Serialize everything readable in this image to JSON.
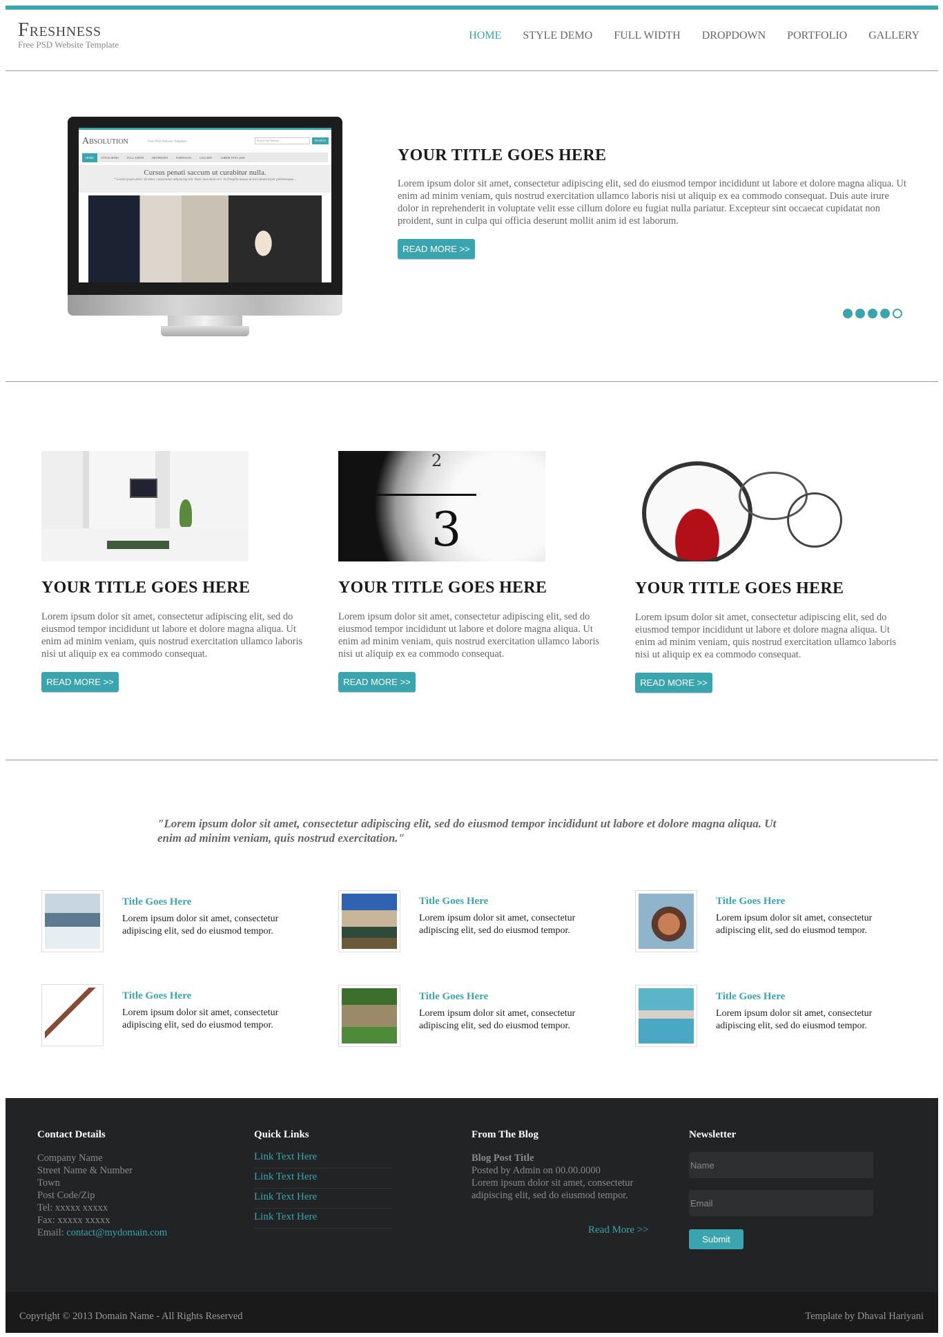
{
  "header": {
    "logo_title": "Freshness",
    "logo_subtitle": "Free PSD Website Template",
    "nav": [
      "HOME",
      "STYLE DEMO",
      "FULL WIDTH",
      "DROPDOWN",
      "PORTFOLIO",
      "GALLERY"
    ],
    "active_nav": "HOME"
  },
  "hero": {
    "screen": {
      "logo": "Absolution",
      "logo_sub": "Free PSD Website Template",
      "search_placeholder": "Search Our Website...",
      "search_button": "SEARCH",
      "nav": [
        "HOME",
        "STYLE DEMO",
        "FULL WIDTH",
        "DROPDOWN",
        "PORTFOLIO",
        "GALLERY",
        "LOREM TEXT LINE"
      ],
      "heading": "Cursus penati saccum ut curabitur nulla.",
      "subtext": "* Lorem ipsum dolor sit amet, consectetur adipiscing elit. Nunc non diam orci. In fringilla massa ut nisi ullamcorper pellentesque..."
    },
    "title": "YOUR TITLE GOES HERE",
    "text": "Lorem ipsum dolor sit amet, consectetur adipiscing elit, sed do eiusmod tempor incididunt ut labore et dolore magna aliqua. Ut enim ad minim veniam, quis nostrud exercitation ullamco laboris nisi ut aliquip ex ea commodo consequat. Duis aute irure dolor in reprehenderit in voluptate velit esse cillum dolore eu fugiat nulla pariatur. Excepteur sint occaecat cupidatat non proident, sunt in culpa qui officia deserunt mollit anim id est laborum.",
    "button": "READ MORE >>",
    "slides_total": 5,
    "slide_active": 5
  },
  "features": [
    {
      "title": "YOUR TITLE GOES HERE",
      "text": "Lorem ipsum dolor sit amet, consectetur adipiscing elit, sed do eiusmod tempor incididunt ut labore et dolore magna aliqua. Ut enim ad minim veniam, quis nostrud exercitation ullamco laboris nisi ut aliquip ex ea commodo consequat.",
      "button": "READ MORE >>"
    },
    {
      "title": "YOUR TITLE GOES HERE",
      "text": "Lorem ipsum dolor sit amet, consectetur adipiscing elit, sed do eiusmod tempor incididunt ut labore et dolore magna aliqua. Ut enim ad minim veniam, quis nostrud exercitation ullamco laboris nisi ut aliquip ex ea commodo consequat.",
      "button": "READ MORE >>"
    },
    {
      "title": "YOUR TITLE GOES HERE",
      "text": "Lorem ipsum dolor sit amet, consectetur adipiscing elit, sed do eiusmod tempor incididunt ut labore et dolore magna aliqua. Ut enim ad minim veniam, quis nostrud exercitation ullamco laboris nisi ut aliquip ex ea commodo consequat.",
      "button": "READ MORE >>"
    }
  ],
  "quote": "\"Lorem ipsum dolor sit amet, consectetur adipiscing elit, sed do eiusmod tempor incididunt ut labore et dolore magna aliqua. Ut enim ad minim veniam, quis nostrud exercitation.\"",
  "posts": [
    {
      "title": "Title Goes Here",
      "text": "Lorem ipsum dolor sit amet, consectetur adipiscing elit, sed do eiusmod tempor."
    },
    {
      "title": "Title Goes Here",
      "text": "Lorem ipsum dolor sit amet, consectetur adipiscing elit, sed do eiusmod tempor."
    },
    {
      "title": "Title Goes Here",
      "text": "Lorem ipsum dolor sit amet, consectetur adipiscing elit, sed do eiusmod tempor."
    },
    {
      "title": "Title Goes Here",
      "text": "Lorem ipsum dolor sit amet, consectetur adipiscing elit, sed do eiusmod tempor."
    },
    {
      "title": "Title Goes Here",
      "text": "Lorem ipsum dolor sit amet, consectetur adipiscing elit, sed do eiusmod tempor."
    },
    {
      "title": "Title Goes Here",
      "text": "Lorem ipsum dolor sit amet, consectetur adipiscing elit, sed do eiusmod tempor."
    }
  ],
  "footer": {
    "contact": {
      "heading": "Contact Details",
      "lines": [
        "Company Name",
        "Street Name & Number",
        "Town",
        "Post Code/Zip",
        "Tel: xxxxx xxxxx",
        "Fax: xxxxx xxxxx"
      ],
      "email_label": "Email: ",
      "email": "contact@mydomain.com"
    },
    "links": {
      "heading": "Quick Links",
      "items": [
        "Link Text Here",
        "Link Text Here",
        "Link Text Here",
        "Link Text Here"
      ]
    },
    "blog": {
      "heading": "From The Blog",
      "post_title": "Blog Post Title",
      "meta": "Posted by Admin on 00.00.0000",
      "excerpt": "Lorem ipsum dolor sit amet, consectetur adipiscing elit, sed do eiusmod tempor.",
      "read_more": "Read More >>"
    },
    "newsletter": {
      "heading": "Newsletter",
      "name_placeholder": "Name",
      "email_placeholder": "Email",
      "submit": "Submit"
    },
    "copyright": "Copyright © 2013 Domain Name - All Rights Reserved",
    "credit": "Template by Dhaval Hariyani"
  },
  "colors": {
    "accent": "#3aa5ae",
    "footer_bg": "#222325",
    "footer_bottom_bg": "#1a1a1b"
  }
}
